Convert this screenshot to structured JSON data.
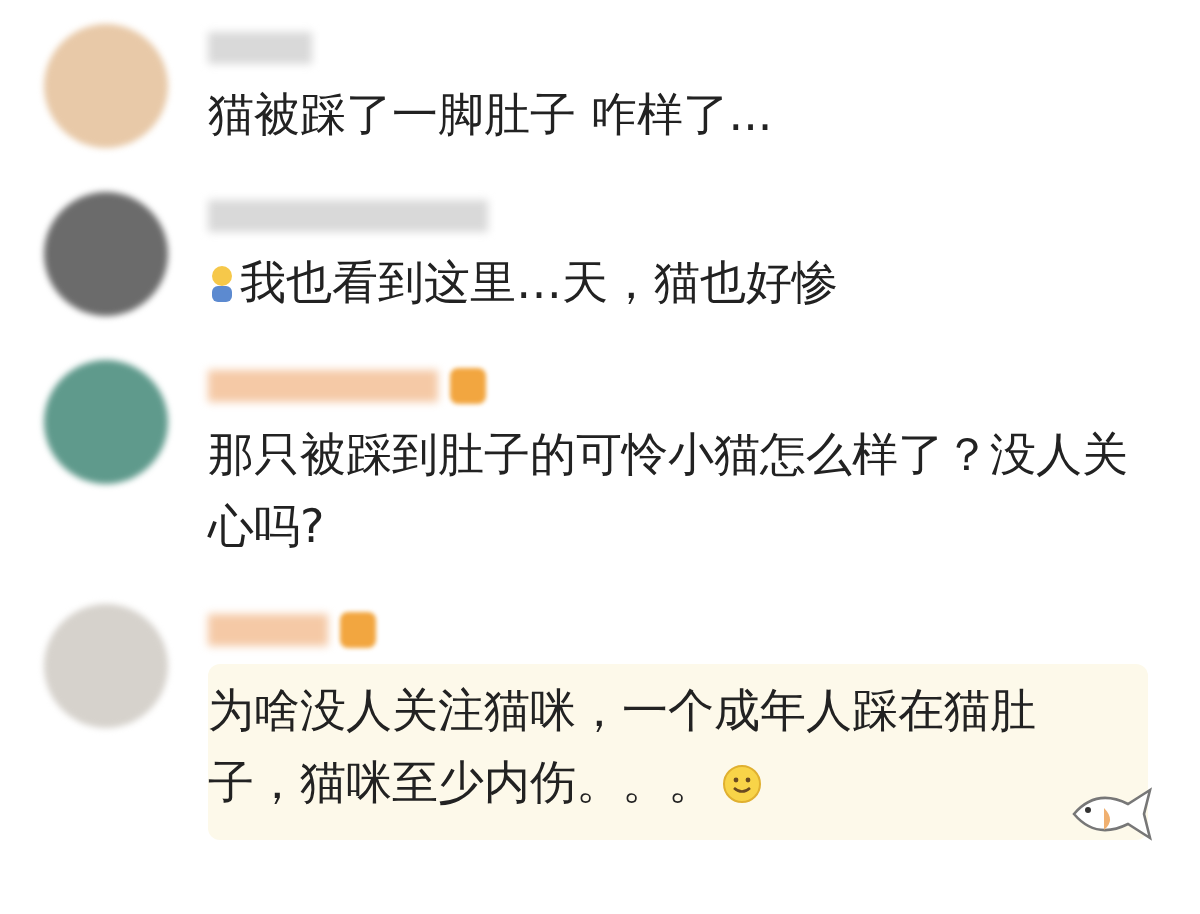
{
  "comments": [
    {
      "text": "猫被踩了一脚肚子 咋样了...",
      "badge": false,
      "leading_emoji": false,
      "trailing_emoji": false,
      "highlighted": false
    },
    {
      "text": "我也看到这里…天，猫也好惨",
      "badge": false,
      "leading_emoji": true,
      "trailing_emoji": false,
      "highlighted": false
    },
    {
      "text": "那只被踩到肚子的可怜小猫怎么样了？没人关心吗?",
      "badge": true,
      "leading_emoji": false,
      "trailing_emoji": false,
      "highlighted": false
    },
    {
      "text": "为啥没人关注猫咪，一个成年人踩在猫肚子，猫咪至少内伤。。。",
      "badge": true,
      "leading_emoji": false,
      "trailing_emoji": true,
      "highlighted": true
    }
  ]
}
